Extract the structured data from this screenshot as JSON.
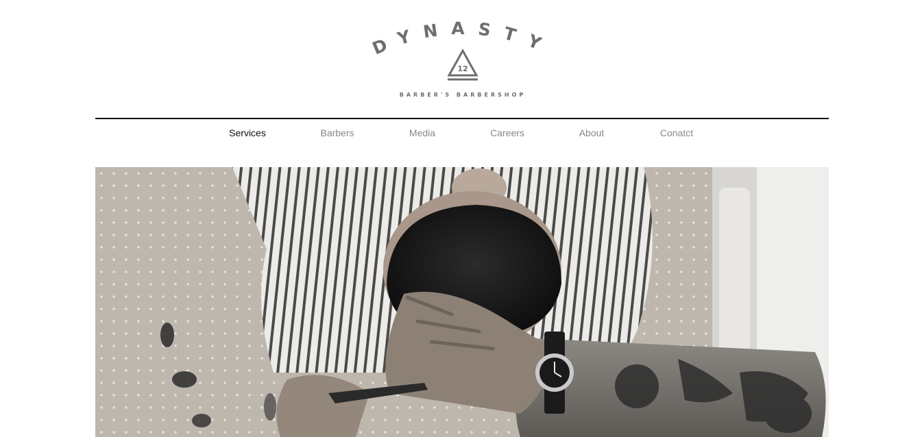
{
  "brand": {
    "name": "DYNASTY",
    "badge_number": "12",
    "tagline": "BARBER'S BARBERSHOP"
  },
  "nav": {
    "items": [
      {
        "label": "Services",
        "active": true
      },
      {
        "label": "Barbers",
        "active": false
      },
      {
        "label": "Media",
        "active": false
      },
      {
        "label": "Careers",
        "active": false
      },
      {
        "label": "About",
        "active": false
      },
      {
        "label": "Conatct",
        "active": false
      }
    ]
  },
  "hero": {
    "image": "hero-barber-photo"
  },
  "colors": {
    "logo_gray": "#6e6e6e",
    "nav_active": "#111111",
    "nav_inactive": "#888888",
    "rule": "#111111"
  }
}
